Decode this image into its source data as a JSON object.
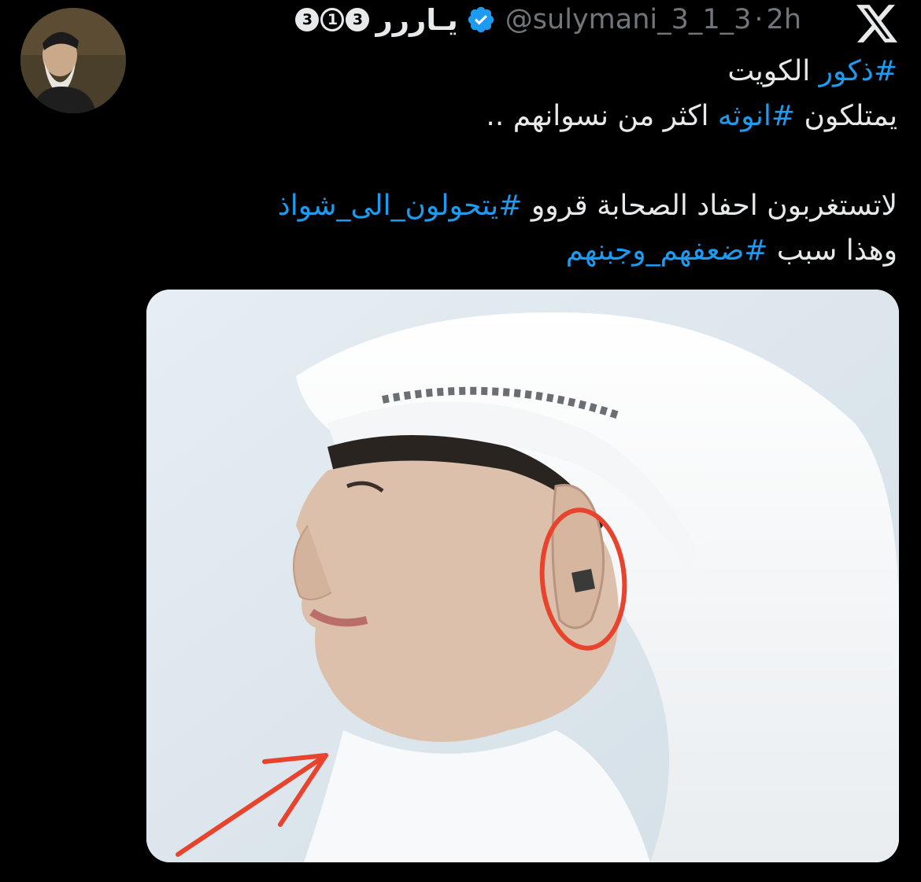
{
  "tweet": {
    "author": {
      "display_name": "يـاﺭﺭﺭ",
      "badges": [
        "3",
        "1",
        "3"
      ],
      "verified": true,
      "handle": "@sulymani_3_1_3",
      "separator": "·",
      "time": "2h"
    },
    "platform_icon": "x-logo-icon",
    "text": {
      "line1": {
        "hashtag": "#ذكور",
        "rest": " الكويت"
      },
      "line2": {
        "part1": "يمتلكون ",
        "hashtag": "#انوثه",
        "part2": " اكثر من نسوانهم .."
      },
      "line3": {
        "part1": "لاتستغربون احفاد الصحابة قروو ",
        "hashtag": "#يتحولون_الى_شواذ"
      },
      "line4": {
        "part1": "وهذا سبب ",
        "hashtag": "#ضعفهم_وجبنهم"
      }
    },
    "media": {
      "kind": "photo",
      "annotations": [
        "red-circle-icon",
        "red-arrow-icon"
      ]
    }
  },
  "colors": {
    "background": "#000000",
    "text": "#e7e9ea",
    "secondary": "#71767b",
    "link": "#1d9bf0",
    "verified": "#1d9bf0",
    "annotation": "#e8432d"
  }
}
